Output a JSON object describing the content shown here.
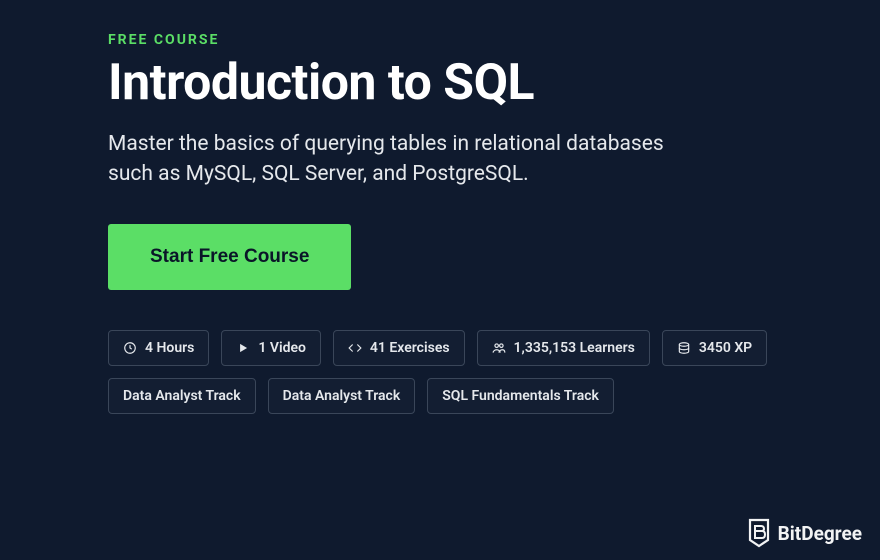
{
  "eyebrow": "FREE COURSE",
  "title": "Introduction to SQL",
  "description": "Master the basics of querying tables in relational databases such as MySQL, SQL Server, and PostgreSQL.",
  "cta_label": "Start Free Course",
  "chips": {
    "duration": "4 Hours",
    "videos": "1 Video",
    "exercises": "41 Exercises",
    "learners": "1,335,153 Learners",
    "xp": "3450 XP",
    "track1": "Data Analyst Track",
    "track2": "Data Analyst Track",
    "track3": "SQL Fundamentals Track"
  },
  "watermark": "BitDegree"
}
